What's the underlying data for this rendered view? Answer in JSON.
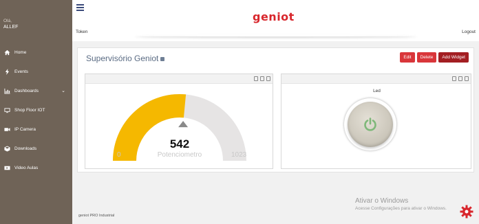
{
  "sidebar": {
    "greeting": "Olá,",
    "user_name": "ALLEF",
    "items": [
      {
        "label": "Home",
        "icon": "home-icon"
      },
      {
        "label": "Events",
        "icon": "bolt-icon"
      },
      {
        "label": "Dashboards",
        "icon": "chart-icon",
        "chevron": "⌄"
      },
      {
        "label": "Shop Floor IOT",
        "icon": "monitor-icon"
      },
      {
        "label": "IP Camera",
        "icon": "camera-icon"
      },
      {
        "label": "Downloads",
        "icon": "cube-icon"
      },
      {
        "label": "Video Aulas",
        "icon": "play-icon"
      }
    ]
  },
  "header": {
    "logo": "geniot",
    "token_label": "Token",
    "logout_label": "Logout"
  },
  "dashboard": {
    "title": "Supervisório Geniot",
    "buttons": {
      "edit": "Edit",
      "delete": "Delete",
      "add_widget": "Add Widget"
    }
  },
  "gauge_widget": {
    "value": "542",
    "label": "Potenciometro",
    "min": "0",
    "max": "1023",
    "fill_fraction": 0.53,
    "fill_color": "#f5b800",
    "track_color": "#e6e4e4"
  },
  "led_widget": {
    "label": "Led",
    "state": "off",
    "icon_color": "#7fb87a"
  },
  "footer": {
    "text": "geniot PRO Industrial"
  },
  "watermark": {
    "line1": "Ativar o Windows",
    "line2": "Acesse Configurações para ativar o Windows."
  },
  "colors": {
    "sidebar": "#6f6357",
    "accent_red": "#d9363a",
    "accent_dark_red": "#a31e22"
  }
}
